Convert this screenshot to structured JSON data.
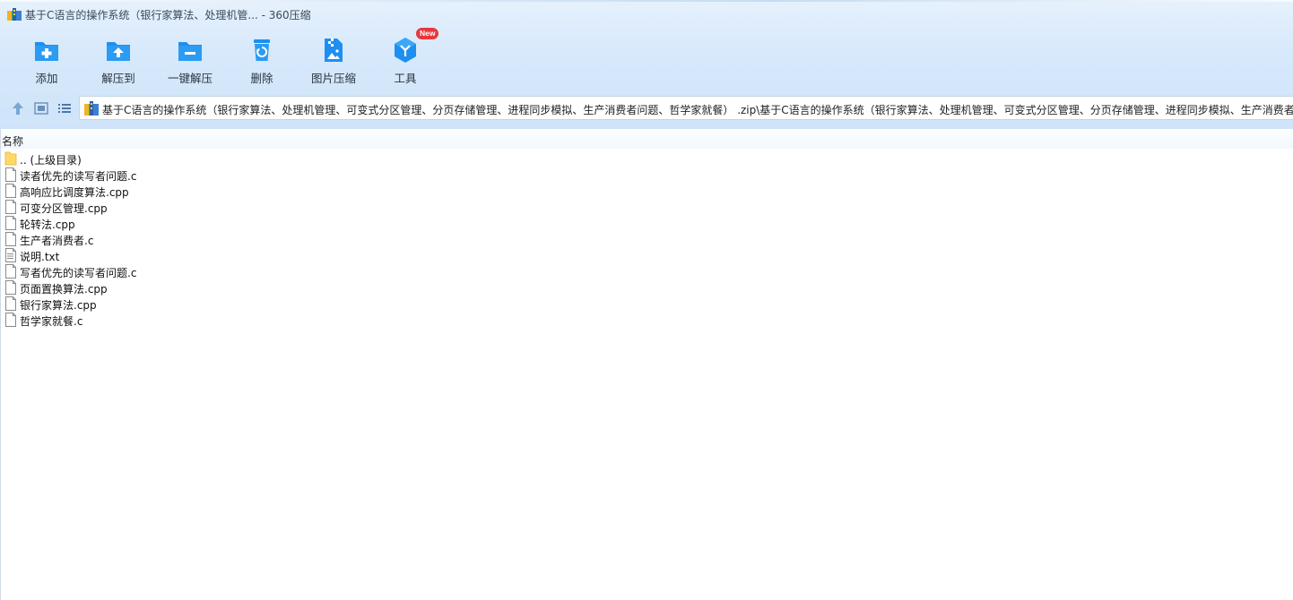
{
  "window": {
    "title": "基于C语言的操作系统（银行家算法、处理机管... - 360压缩"
  },
  "toolbar": {
    "items": [
      {
        "label": "添加",
        "icon": "add-folder-icon"
      },
      {
        "label": "解压到",
        "icon": "extract-to-icon"
      },
      {
        "label": "一键解压",
        "icon": "one-click-extract-icon"
      },
      {
        "label": "删除",
        "icon": "delete-icon"
      },
      {
        "label": "图片压缩",
        "icon": "image-compress-icon"
      },
      {
        "label": "工具",
        "icon": "tools-icon",
        "badge": "New"
      }
    ]
  },
  "address": {
    "path": "基于C语言的操作系统（银行家算法、处理机管理、可变式分区管理、分页存储管理、进程同步模拟、生产消费者问题、哲学家就餐） .zip\\基于C语言的操作系统（银行家算法、处理机管理、可变式分区管理、分页存储管理、进程同步模拟、生产消费者问题、哲学家就餐）"
  },
  "list": {
    "column_name": "名称",
    "files": [
      {
        "name": ".. (上级目录)",
        "type": "folder"
      },
      {
        "name": "读者优先的读写者问题.c",
        "type": "file"
      },
      {
        "name": "高响应比调度算法.cpp",
        "type": "file"
      },
      {
        "name": "可变分区管理.cpp",
        "type": "file"
      },
      {
        "name": "轮转法.cpp",
        "type": "file"
      },
      {
        "name": "生产者消费者.c",
        "type": "file"
      },
      {
        "name": "说明.txt",
        "type": "text"
      },
      {
        "name": "写者优先的读写者问题.c",
        "type": "file"
      },
      {
        "name": "页面置换算法.cpp",
        "type": "file"
      },
      {
        "name": "银行家算法.cpp",
        "type": "file"
      },
      {
        "name": "哲学家就餐.c",
        "type": "file"
      }
    ]
  },
  "colors": {
    "accent": "#1e8ff0",
    "header_bg": "#d7e9fb",
    "badge": "#e8383d"
  }
}
